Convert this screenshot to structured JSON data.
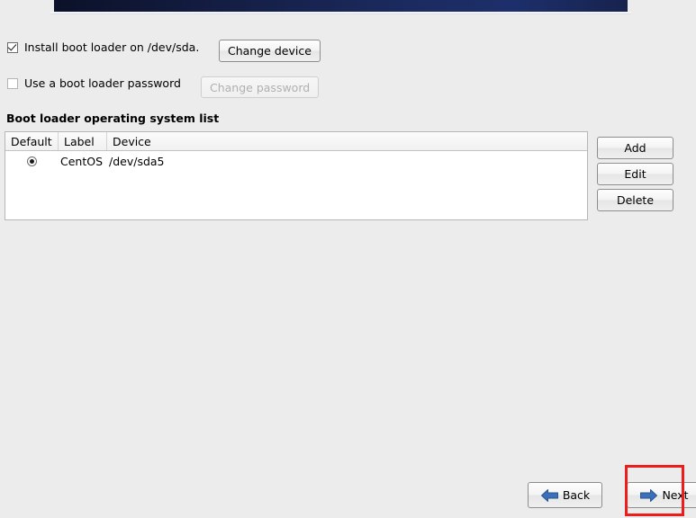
{
  "banner": {
    "name": "installer-banner",
    "gradient_start": "#0b1128",
    "gradient_end": "#1d2f6b"
  },
  "options": {
    "bootloader": {
      "label": "Install boot loader on /dev/sda.",
      "checked": true,
      "button_label": "Change device",
      "button_enabled": true
    },
    "password": {
      "label": "Use a boot loader password",
      "checked": false,
      "button_label": "Change password",
      "button_enabled": false
    }
  },
  "section": {
    "heading": "Boot loader operating system list"
  },
  "os_list": {
    "columns": [
      "Default",
      "Label",
      "Device"
    ],
    "rows": [
      {
        "default": true,
        "label": "CentOS",
        "device": "/dev/sda5"
      }
    ]
  },
  "list_actions": [
    {
      "name": "add-button",
      "label": "Add"
    },
    {
      "name": "edit-button",
      "label": "Edit"
    },
    {
      "name": "delete-button",
      "label": "Delete"
    }
  ],
  "navigation": {
    "back_label": "Back",
    "next_label": "Next",
    "arrow_color": "#3b6fba",
    "highlight_color": "#ee1d1d"
  }
}
